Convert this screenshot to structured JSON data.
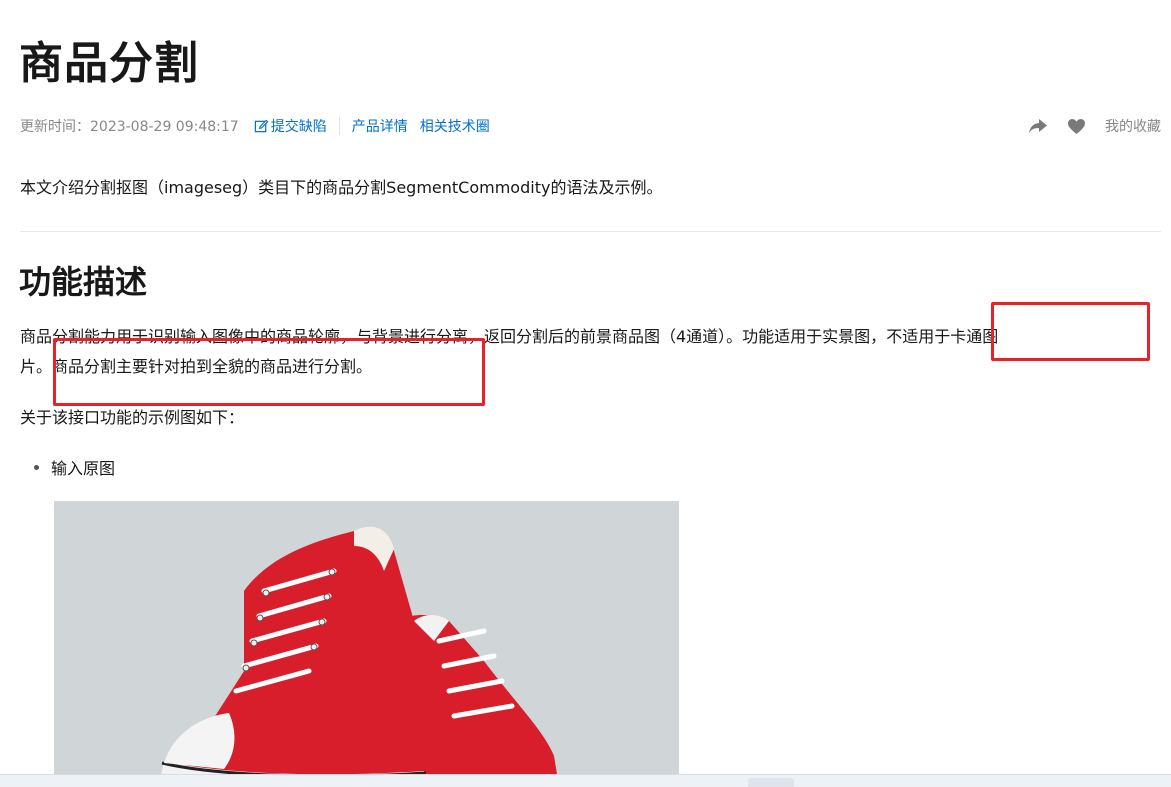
{
  "page": {
    "title": "商品分割",
    "update_label": "更新时间：2023-08-29 09:48:17",
    "report_bug": "提交缺陷",
    "product_details": "产品详情",
    "tech_circle": "相关技术圈",
    "favorites": "我的收藏"
  },
  "intro": "本文介绍分割抠图（imageseg）类目下的商品分割SegmentCommodity的语法及示例。",
  "section": {
    "title": "功能描述",
    "desc_line1": "商品分割能力用于识别输入图像中的商品轮廓，与背景进行分离，返回分割后的前景商品图（4通道）。功能适用于实景图，",
    "desc_line1_tail": "不适用于卡通图",
    "desc_line2": "片。商品分割主要针对拍到全貌的商品进行分割。",
    "example_intro": "关于该接口功能的示例图如下：",
    "list_items": [
      "输入原图"
    ]
  },
  "icons": {
    "edit": "edit-icon",
    "share": "share-icon",
    "favorite": "heart-icon"
  },
  "colors": {
    "link": "#0070cc",
    "highlight": "#e8212b",
    "shoe": "#d81e2a",
    "image_bg": "#d0d5d8"
  }
}
